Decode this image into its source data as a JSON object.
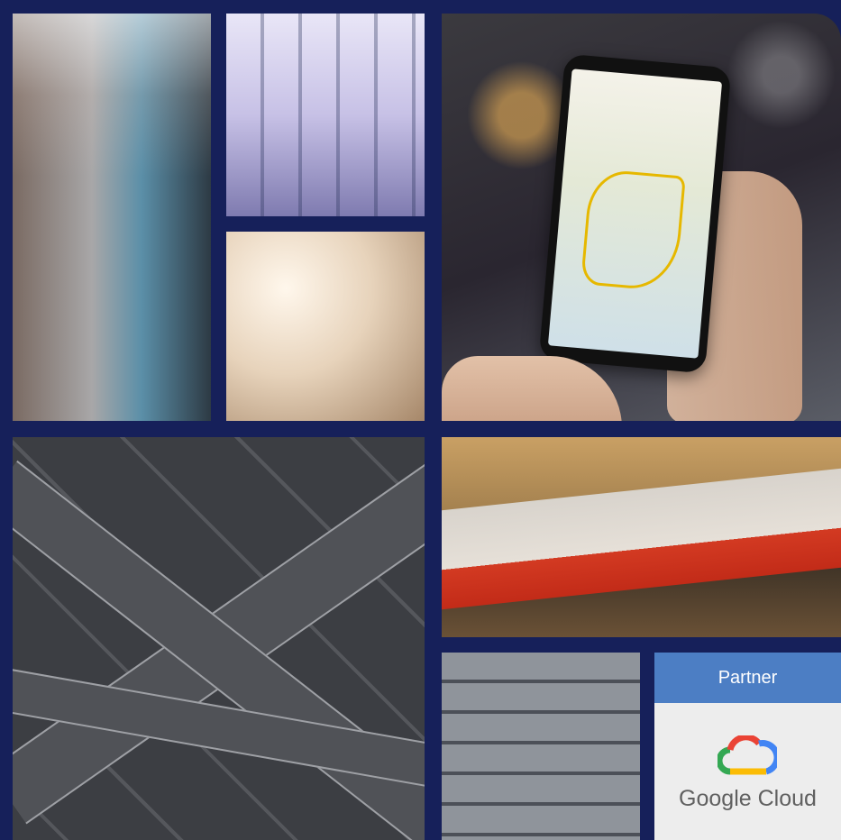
{
  "partner_badge": {
    "heading": "Partner",
    "brand": "Google Cloud",
    "logo_icon": "google-cloud-logo-icon",
    "header_color": "#4c7ec4"
  },
  "background_color": "#16205a",
  "tiles": [
    "woman-bike-share-photo",
    "people-walking-silhouettes-photo",
    "wheelchair-photo",
    "phone-map-navigation-photo",
    "highway-interchange-aerial-photo",
    "tram-motion-photo",
    "automated-parking-garage-photo"
  ]
}
